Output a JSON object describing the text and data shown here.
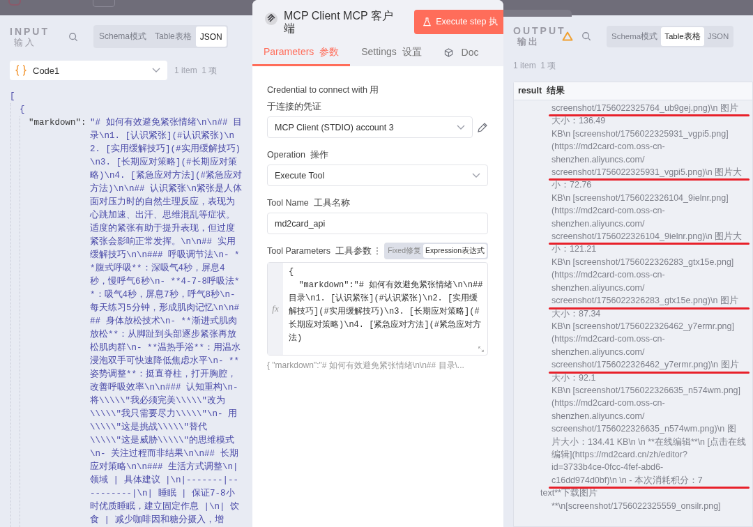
{
  "input": {
    "title": "INPUT",
    "subtitle": "输入",
    "tabs": [
      {
        "label": "Schema模式",
        "selected": false
      },
      {
        "label": "Table表格",
        "selected": false
      },
      {
        "label": "JSON",
        "selected": true
      }
    ],
    "source": "Code1",
    "count": "1 item  1 项",
    "json": {
      "open_bracket": "[",
      "open_brace": "{",
      "key": "\"markdown\":",
      "value": "\"# 如何有效避免紧张情绪\\n\\n## 目录\\n1. [认识紧张](#认识紧张)\\n2. [实用缓解技巧](#实用缓解技巧)\\n3. [长期应对策略](#长期应对策略)\\n4. [紧急应对方法](#紧急应对方法)\\n\\n## 认识紧张\\n紧张是人体面对压力时的自然生理反应，表现为心跳加速、出汗、思维混乱等症状。适度的紧张有助于提升表现，但过度紧张会影响正常发挥。\\n\\n## 实用缓解技巧\\n\\n### 呼吸调节法\\n- **腹式呼吸**：深吸气4秒，屏息4秒，慢呼气6秒\\n- **4-7-8呼吸法**：吸气4秒，屏息7秒，呼气8秒\\n- 每天练习5分钟，形成肌肉记忆\\n\\n### 身体放松技术\\n- **渐进式肌肉放松**：从脚趾到头部逐步紧张再放松肌肉群\\n- **温热手浴**：用温水浸泡双手可快速降低焦虑水平\\n- **姿势调整**：挺直脊柱，打开胸腔，改善呼吸效率\\n\\n### 认知重构\\n- 将\\\\\\\\\\\"我必须完美\\\\\\\\\\\"改为\\\\\\\\\\\"我只需要尽力\\\\\\\\\\\"\\n- 用\\\\\\\\\\\"这是挑战\\\\\\\\\\\"替代\\\\\\\\\\\"这是威胁\\\\\\\\\\\"的思维模式\\n- 关注过程而非结果\\n\\n## 长期应对策略\\n\\n### 生活方式调整\\n| 领域 | 具体建议 |\\n|-------|----------|\\n| 睡眠 | 保证7-8小时优质睡眠，建立固定作息 |\\n| 饮食 | 减少咖啡因和糖分摄入，增"
    }
  },
  "node": {
    "title": "MCP Client  MCP 客户端",
    "execute_button": "Execute step 执",
    "tabs": [
      {
        "label": "Parameters  参数",
        "selected": true,
        "kind": "text"
      },
      {
        "label": "Settings  设置",
        "selected": false,
        "kind": "text"
      },
      {
        "label": "Doc",
        "selected": false,
        "kind": "docs"
      }
    ],
    "fields": [
      {
        "kind": "select",
        "label": "Credential to connect with 用于连接的凭证",
        "value": "MCP Client (STDIO) account 3",
        "editable": true
      },
      {
        "kind": "select",
        "label": "Operation  操作",
        "value": "Execute Tool",
        "editable": false
      },
      {
        "kind": "text",
        "label": "Tool Name  工具名称",
        "value": "md2card_api",
        "editable": false
      }
    ],
    "parameters": {
      "label": "Tool Parameters  工具参数",
      "modes": [
        {
          "label": "Fixed修复",
          "selected": false
        },
        {
          "label": "Expression表达式",
          "selected": true
        }
      ],
      "gutter": "fx",
      "code_lines": [
        "{",
        "  \"markdown\":\"# 如何有效避免紧张情绪\\n\\n## 目录\\n1. [认识紧张](#认识紧张)\\n2. [实用缓解技巧](#实用缓解技巧)\\n3. [长期应对策略](#长期应对策略)\\n4. [紧急应对方法](#紧急应对方法)"
      ],
      "preview": "{  \"markdown\":\"# 如何有效避免紧张情绪\\n\\n## 目录\\..."
    }
  },
  "output": {
    "title": "OUTPUT",
    "subtitle": "输出",
    "warning": true,
    "tabs": [
      {
        "label": "Schema模式",
        "selected": false
      },
      {
        "label": "Table表格",
        "selected": true
      },
      {
        "label": "JSON",
        "selected": false
      }
    ],
    "count": "1 item  1 项",
    "column": "result  结果",
    "lines": [
      {
        "text": "screenshot/1756022325764_ub9gej.png)\\n 图片",
        "marked": true
      },
      {
        "text": "大小：136.49",
        "marked": false
      },
      {
        "text": "KB\\n [screenshot/1756022325931_vgpi5.png]",
        "marked": false
      },
      {
        "text": "(https://md2card-com.oss-cn-",
        "marked": false
      },
      {
        "text": "shenzhen.aliyuncs.com/",
        "marked": false
      },
      {
        "text": "screenshot/1756022325931_vgpi5.png)\\n 图片大",
        "marked": true
      },
      {
        "text": "小：72.76",
        "marked": false
      },
      {
        "text": "KB\\n [screenshot/1756022326104_9ielnr.png]",
        "marked": false
      },
      {
        "text": "(https://md2card-com.oss-cn-",
        "marked": false
      },
      {
        "text": "shenzhen.aliyuncs.com/",
        "marked": false
      },
      {
        "text": "screenshot/1756022326104_9ielnr.png)\\n 图片大",
        "marked": true
      },
      {
        "text": "小：121.21",
        "marked": false
      },
      {
        "text": "KB\\n [screenshot/1756022326283_gtx15e.png]",
        "marked": false
      },
      {
        "text": "(https://md2card-com.oss-cn-",
        "marked": false
      },
      {
        "text": "shenzhen.aliyuncs.com/",
        "marked": false
      },
      {
        "text": "screenshot/1756022326283_gtx15e.png)\\n 图片",
        "marked": true
      },
      {
        "text": "大小：87.34",
        "marked": false
      },
      {
        "text": "KB\\n [screenshot/1756022326462_y7ermr.png]",
        "marked": false
      },
      {
        "text": "(https://md2card-com.oss-cn-",
        "marked": false
      },
      {
        "text": "shenzhen.aliyuncs.com/",
        "marked": false
      },
      {
        "text": "screenshot/1756022326462_y7ermr.png)\\n 图片",
        "marked": true
      },
      {
        "text": "大小：92.1",
        "marked": false
      },
      {
        "text": "KB\\n [screenshot/1756022326635_n574wm.png]",
        "marked": false
      },
      {
        "text": "(https://md2card-com.oss-cn-",
        "marked": false
      },
      {
        "text": "shenzhen.aliyuncs.com/",
        "marked": false
      },
      {
        "text": "screenshot/1756022326635_n574wm.png)\\n 图",
        "marked": false
      },
      {
        "text": "片大小：134.41 KB\\n \\n **在线编辑**\\n [点击在线",
        "marked": false
      },
      {
        "text": "编辑](https://md2card.cn/zh/editor?",
        "marked": false
      },
      {
        "text": "id=3733b4ce-0fcc-4fef-abd6-",
        "marked": false
      },
      {
        "text": "c16dd974d0bf)\\n \\n - 本次消耗积分：7",
        "marked": true
      }
    ],
    "sub_key": "text**下载图片",
    "sub_lines": [
      "**\\n[screenshot/1756022325559_onsilr.png]"
    ]
  }
}
